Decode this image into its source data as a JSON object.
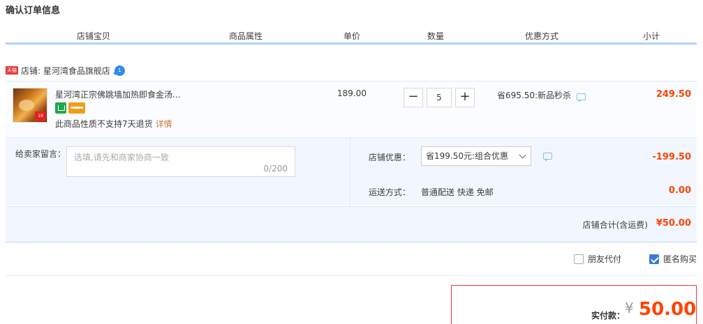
{
  "page_title": "确认订单信息",
  "columns": [
    "店铺宝贝",
    "商品属性",
    "单价",
    "数量",
    "优惠方式",
    "小计"
  ],
  "shop": {
    "badge": "天猫",
    "label": "店铺: 星河湾食品旗舰店",
    "chat_badge": "1"
  },
  "item": {
    "image_sticker": "19",
    "title": "星河湾正宗佛跳墙加热即食金汤...",
    "no_return_text": "此商品性质不支持7天退货",
    "detail_link": "详情",
    "unit_price": "189.00",
    "qty_minus": "−",
    "qty_value": "5",
    "qty_plus": "+",
    "promo_text": "省695.50:新品秒杀",
    "subtotal": "249.50"
  },
  "memo": {
    "label": "给卖家留言：",
    "placeholder": "选填,请先和商家协商一致",
    "count": "0/200"
  },
  "coupon": {
    "label": "店铺优惠：",
    "selected": "省199.50元:组合优惠",
    "discount": "-199.50"
  },
  "shipping": {
    "label": "运送方式：",
    "method": "普通配送 快递 免邮",
    "fee": "0.00"
  },
  "shop_total": {
    "label": "店铺合计(含运费)",
    "value": "¥50.00"
  },
  "options": {
    "friend_pay": {
      "label": "朋友代付",
      "checked": false
    },
    "anonymous": {
      "label": "匿名购买",
      "checked": true
    }
  },
  "payment": {
    "label": "实付款：",
    "currency": "¥",
    "amount": "50.00"
  },
  "colors": {
    "price_red": "#ff4400",
    "header_line": "#b2d1ff",
    "panel_bg": "#f2f7ff",
    "checkbox_blue": "#3d7bd8"
  }
}
